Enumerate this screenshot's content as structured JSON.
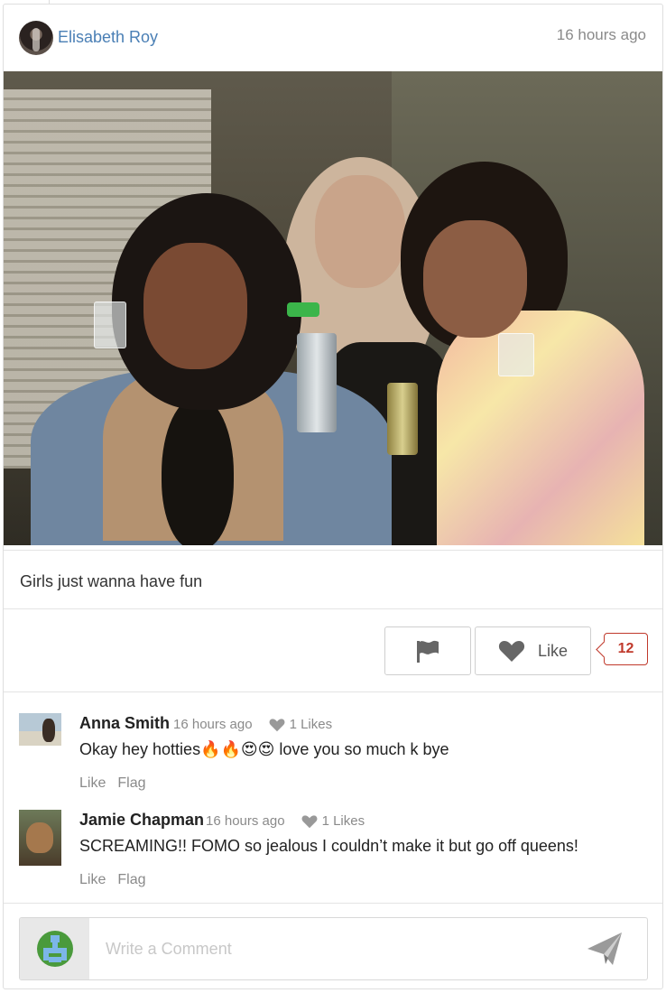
{
  "post": {
    "author": "Elisabeth Roy",
    "time": "16 hours ago",
    "caption": "Girls just wanna have fun",
    "photo_icon": "group-photo"
  },
  "actions": {
    "flag_icon": "flag-icon",
    "like_label": "Like",
    "like_count": "12",
    "badge_color": "#c0392b"
  },
  "comments": [
    {
      "author": "Anna Smith",
      "time": "16 hours ago",
      "likes": "1 Likes",
      "text": "Okay hey hotties🔥🔥😍😍 love you so much k bye",
      "like_action": "Like",
      "flag_action": "Flag"
    },
    {
      "author": "Jamie Chapman",
      "time": "16 hours ago",
      "likes": "1 Likes",
      "text": "SCREAMING!! FOMO so jealous I couldn’t make it but go off queens!",
      "like_action": "Like",
      "flag_action": "Flag"
    }
  ],
  "composer": {
    "placeholder": "Write a Comment",
    "send_icon": "send-icon"
  },
  "colors": {
    "author_link": "#4a7fb5",
    "muted": "#8a8a8a"
  }
}
